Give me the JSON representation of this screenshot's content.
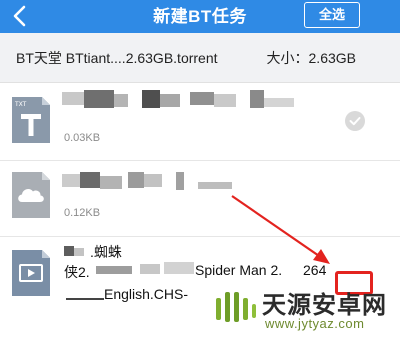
{
  "header": {
    "title": "新建BT任务",
    "select_all": "全选",
    "color": "#2f8ae5"
  },
  "info": {
    "name": "BT天堂 BTtiant....2.63GB.torrent",
    "size": "大小：2.63GB"
  },
  "files": [
    {
      "icon": "txt-file-icon",
      "icon_label": "TXT",
      "size": "0.03KB"
    },
    {
      "icon": "cloud-file-icon",
      "size": "0.12KB"
    },
    {
      "icon": "video-file-icon",
      "line1": ".蜘蛛",
      "line2": "侠2.",
      "line2b": "Spider Man 2.",
      "line2c": "264",
      "line3": "English.CHS-"
    }
  ],
  "watermark": {
    "text": "天源安卓网",
    "url": "www.jytyaz.com"
  }
}
